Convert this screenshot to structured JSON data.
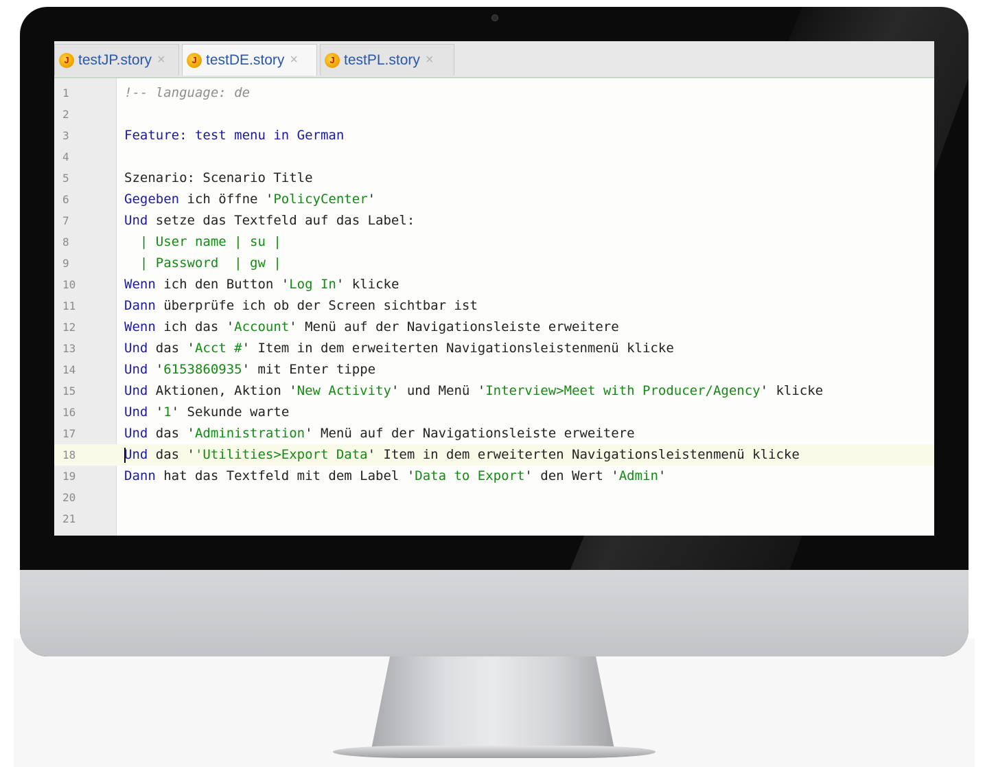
{
  "tabs": [
    {
      "icon": "jbehave-story-icon",
      "label": "testJP.story",
      "active": false
    },
    {
      "icon": "jbehave-story-icon",
      "label": "testDE.story",
      "active": true
    },
    {
      "icon": "jbehave-story-icon",
      "label": "testPL.story",
      "active": false
    }
  ],
  "tab_icon_glyph": "J",
  "tab_close_glyph": "×",
  "colors": {
    "keyword": "#1a1aa6",
    "string": "#138a13",
    "comment": "#8d8d8d",
    "line_number": "#8a8a8a",
    "current_line": "#fafae9"
  },
  "editor": {
    "current_line": 18,
    "lines": [
      {
        "n": "1",
        "segments": [
          {
            "t": "!-- language: de",
            "c": "cmt"
          }
        ]
      },
      {
        "n": "2",
        "segments": []
      },
      {
        "n": "3",
        "segments": [
          {
            "t": "Feature: test menu in German",
            "c": "kw"
          }
        ]
      },
      {
        "n": "4",
        "segments": []
      },
      {
        "n": "5",
        "segments": [
          {
            "t": "Szenario: Scenario Title",
            "c": ""
          }
        ]
      },
      {
        "n": "6",
        "segments": [
          {
            "t": "Gegeben",
            "c": "kw"
          },
          {
            "t": " ich öffne '",
            "c": ""
          },
          {
            "t": "PolicyCenter",
            "c": "str"
          },
          {
            "t": "'",
            "c": ""
          }
        ]
      },
      {
        "n": "7",
        "segments": [
          {
            "t": "Und",
            "c": "kw"
          },
          {
            "t": " setze das Textfeld auf das Label:",
            "c": ""
          }
        ]
      },
      {
        "n": "8",
        "segments": [
          {
            "t": "  | User name | su |",
            "c": "str"
          }
        ]
      },
      {
        "n": "9",
        "segments": [
          {
            "t": "  | Password  | gw |",
            "c": "str"
          }
        ]
      },
      {
        "n": "10",
        "segments": [
          {
            "t": "Wenn",
            "c": "kw"
          },
          {
            "t": " ich den Button '",
            "c": ""
          },
          {
            "t": "Log In",
            "c": "str"
          },
          {
            "t": "' klicke",
            "c": ""
          }
        ]
      },
      {
        "n": "11",
        "segments": [
          {
            "t": "Dann",
            "c": "kw"
          },
          {
            "t": " überprüfe ich ob der Screen sichtbar ist",
            "c": ""
          }
        ]
      },
      {
        "n": "12",
        "segments": [
          {
            "t": "Wenn",
            "c": "kw"
          },
          {
            "t": " ich das '",
            "c": ""
          },
          {
            "t": "Account",
            "c": "str"
          },
          {
            "t": "' Menü auf der Navigationsleiste erweitere",
            "c": ""
          }
        ]
      },
      {
        "n": "13",
        "segments": [
          {
            "t": "Und",
            "c": "kw"
          },
          {
            "t": " das '",
            "c": ""
          },
          {
            "t": "Acct #",
            "c": "str"
          },
          {
            "t": "' Item in dem erweiterten Navigationsleistenmenü klicke",
            "c": ""
          }
        ]
      },
      {
        "n": "14",
        "segments": [
          {
            "t": "Und",
            "c": "kw"
          },
          {
            "t": " '",
            "c": ""
          },
          {
            "t": "6153860935",
            "c": "str"
          },
          {
            "t": "' mit Enter tippe",
            "c": ""
          }
        ]
      },
      {
        "n": "15",
        "segments": [
          {
            "t": "Und",
            "c": "kw"
          },
          {
            "t": " Aktionen, Aktion '",
            "c": ""
          },
          {
            "t": "New Activity",
            "c": "str"
          },
          {
            "t": "' und Menü '",
            "c": ""
          },
          {
            "t": "Interview>Meet with Producer/Agency",
            "c": "str"
          },
          {
            "t": "' klicke",
            "c": ""
          }
        ]
      },
      {
        "n": "16",
        "segments": [
          {
            "t": "Und",
            "c": "kw"
          },
          {
            "t": " '",
            "c": ""
          },
          {
            "t": "1",
            "c": "str"
          },
          {
            "t": "' Sekunde warte",
            "c": ""
          }
        ]
      },
      {
        "n": "17",
        "segments": [
          {
            "t": "Und",
            "c": "kw"
          },
          {
            "t": " das '",
            "c": ""
          },
          {
            "t": "Administration",
            "c": "str"
          },
          {
            "t": "' Menü auf der Navigationsleiste erweitere",
            "c": ""
          }
        ]
      },
      {
        "n": "18",
        "segments": [
          {
            "t": "Und",
            "c": "kw"
          },
          {
            "t": " das '",
            "c": ""
          },
          {
            "t": "'Utilities>Export Data",
            "c": "str"
          },
          {
            "t": "' Item in dem erweiterten Navigationsleistenmenü klicke",
            "c": ""
          }
        ]
      },
      {
        "n": "19",
        "segments": [
          {
            "t": "Dann",
            "c": "kw"
          },
          {
            "t": " hat das Textfeld mit dem Label '",
            "c": ""
          },
          {
            "t": "Data to Export",
            "c": "str"
          },
          {
            "t": "' den Wert '",
            "c": ""
          },
          {
            "t": "Admin",
            "c": "str"
          },
          {
            "t": "'",
            "c": ""
          }
        ]
      },
      {
        "n": "20",
        "segments": []
      },
      {
        "n": "21",
        "segments": []
      }
    ]
  }
}
